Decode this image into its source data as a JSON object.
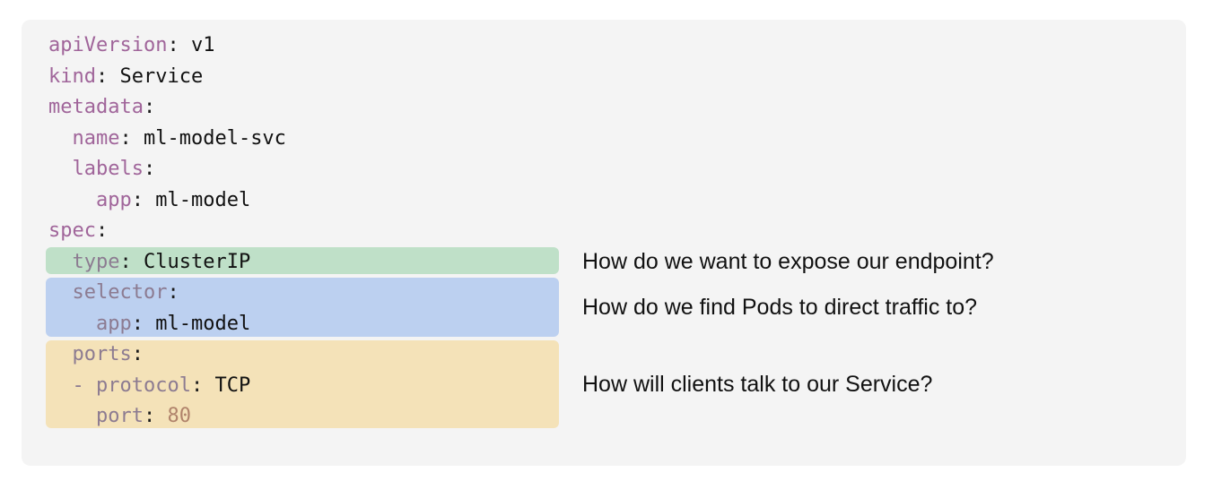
{
  "colors": {
    "panel_background": "#f4f4f4",
    "key": "#a0659a",
    "dim_key": "#8c7b91",
    "value": "#111111",
    "port_value": "#b0836b",
    "highlight_type": "#bfe0c8",
    "highlight_selector": "#bcd0f0",
    "highlight_ports": "#f4e2b8"
  },
  "yaml": {
    "line1": {
      "key": "apiVersion",
      "sep": ": ",
      "value": "v1"
    },
    "line2": {
      "key": "kind",
      "sep": ": ",
      "value": "Service"
    },
    "line3": {
      "key": "metadata",
      "sep": ":"
    },
    "line4": {
      "indent": "  ",
      "key": "name",
      "sep": ": ",
      "value": "ml-model-svc"
    },
    "line5": {
      "indent": "  ",
      "key": "labels",
      "sep": ":"
    },
    "line6": {
      "indent": "    ",
      "key": "app",
      "sep": ": ",
      "value": "ml-model"
    },
    "line7": {
      "key": "spec",
      "sep": ":"
    },
    "line8": {
      "indent": "  ",
      "key": "type",
      "sep": ": ",
      "value": "ClusterIP"
    },
    "line9": {
      "indent": "  ",
      "key": "selector",
      "sep": ":"
    },
    "line10": {
      "indent": "    ",
      "key": "app",
      "sep": ": ",
      "value": "ml-model"
    },
    "line11": {
      "indent": "  ",
      "key": "ports",
      "sep": ":"
    },
    "line12": {
      "indent": "  ",
      "dash": "- ",
      "key": "protocol",
      "sep": ": ",
      "value": "TCP"
    },
    "line13": {
      "indent": "    ",
      "key": "port",
      "sep": ": ",
      "value": "80"
    }
  },
  "annotations": {
    "type": "How do we want to expose our endpoint?",
    "selector": "How do we find Pods to direct traffic to?",
    "ports": "How will clients talk to our Service?"
  }
}
